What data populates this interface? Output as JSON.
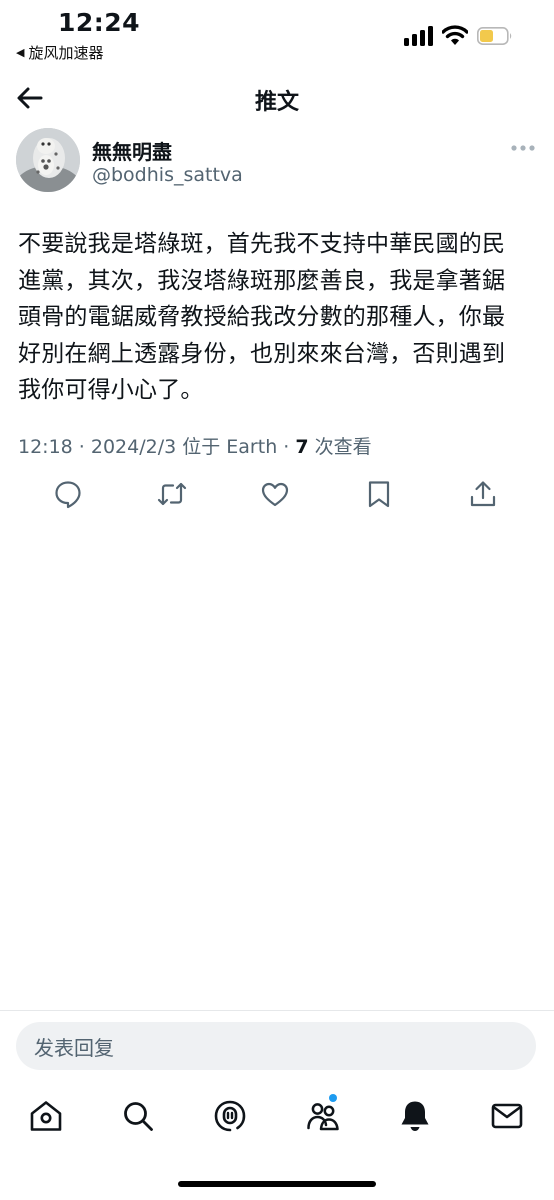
{
  "status_bar": {
    "time": "12:24",
    "back_app": "旋风加速器",
    "battery_color": "#f2c94c"
  },
  "header": {
    "title": "推文"
  },
  "author": {
    "name": "無無明盡",
    "handle": "@bodhis_sattva"
  },
  "tweet": {
    "lines": [
      "不要說我是塔綠斑，首先我不支持中華民國的民",
      "進黨，其次，我沒塔綠斑那麼善良，我是拿著鋸",
      "頭骨的電鋸威脅教授給我改分數的那種人，你最",
      "好別在網上透露身份，也別來來台灣，否則遇到",
      "我你可得小心了。"
    ],
    "meta_prefix": "12:18 · 2024/2/3 位于 Earth · ",
    "views_count": "7",
    "views_label": " 次查看"
  },
  "actions": [
    "reply-icon",
    "retweet-icon",
    "like-icon",
    "bookmark-icon",
    "share-icon"
  ],
  "reply_bar": {
    "placeholder": "发表回复"
  },
  "bottom_nav": [
    "home-icon",
    "search-icon",
    "spaces-icon",
    "communities-icon",
    "notifications-icon",
    "messages-icon"
  ],
  "colors": {
    "accent": "#1d9bf0",
    "text_secondary": "#536471"
  }
}
